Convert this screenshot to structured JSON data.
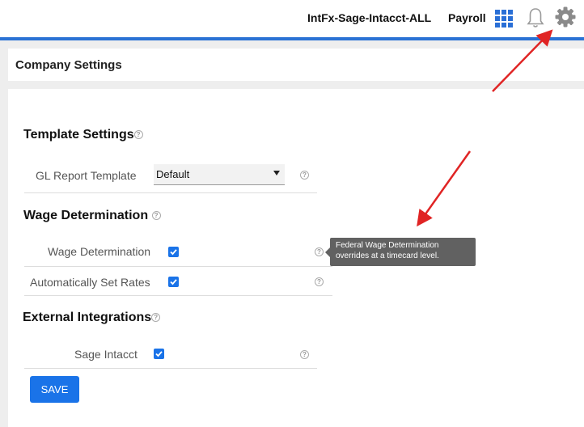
{
  "header": {
    "company": "IntFx-Sage-Intacct-ALL",
    "product": "Payroll",
    "icons": [
      "apps-grid-icon",
      "bell-icon",
      "gear-icon"
    ],
    "accent_color": "#2a72d4"
  },
  "page": {
    "title": "Company Settings"
  },
  "sections": {
    "template": {
      "title": "Template Settings",
      "gl_label": "GL Report Template",
      "gl_value": "Default"
    },
    "wage": {
      "title": "Wage Determination",
      "wage_label": "Wage Determination",
      "wage_checked": true,
      "auto_label": "Automatically Set Rates",
      "auto_checked": true
    },
    "external": {
      "title": "External Integrations",
      "sage_label": "Sage Intacct",
      "sage_checked": true
    }
  },
  "tooltip": {
    "line1": "Federal Wage Determination",
    "line2": "overrides at a timecard level."
  },
  "help_glyph": "?",
  "save_label": "SAVE",
  "button_color": "#1a73e8",
  "annotation_color": "#e02424"
}
